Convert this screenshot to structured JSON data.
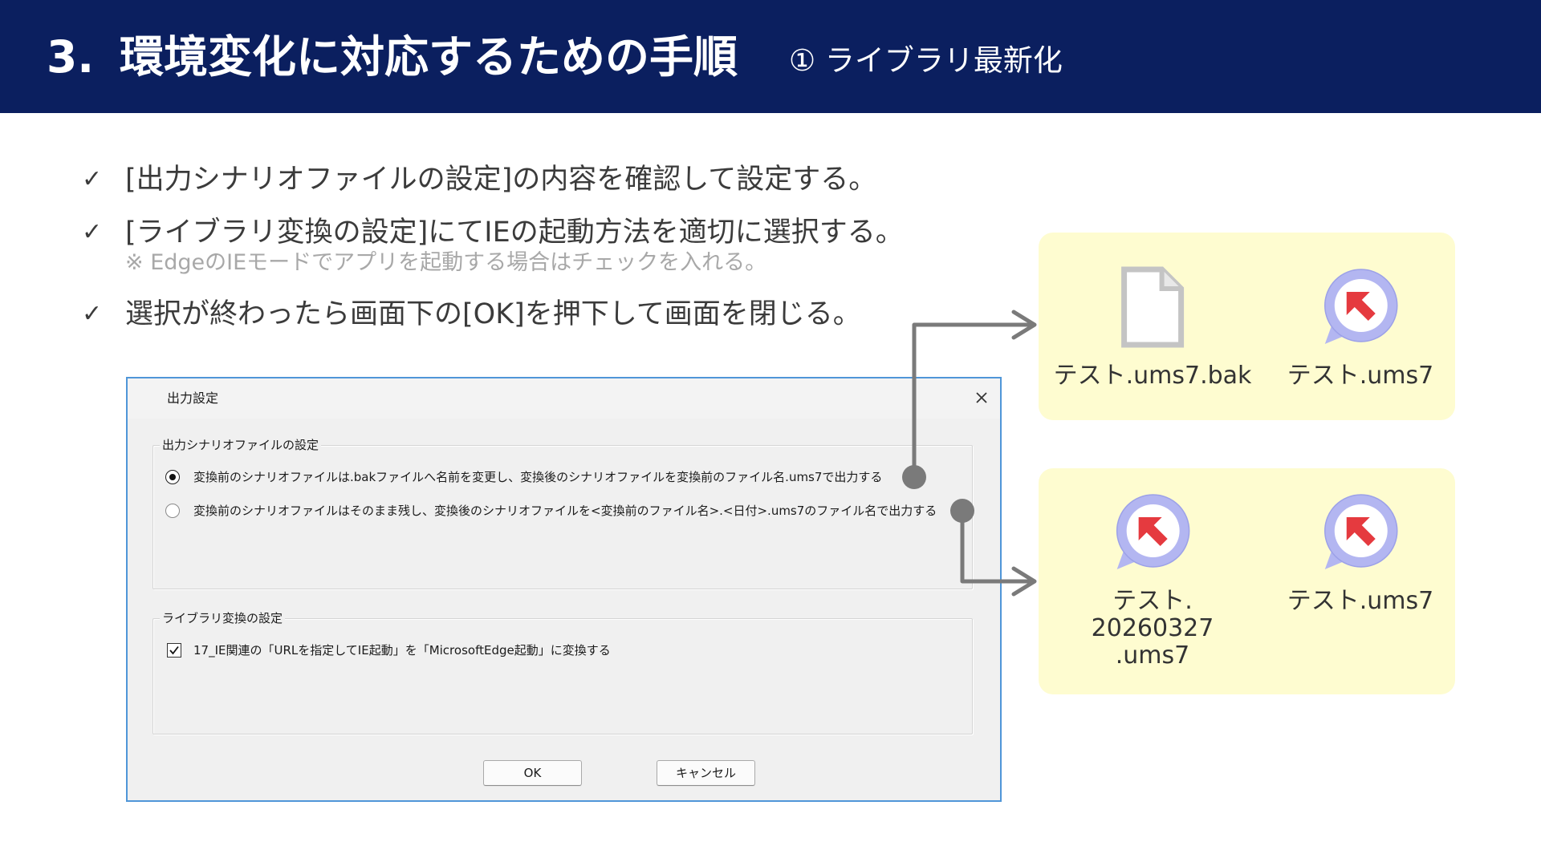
{
  "colors": {
    "header_bg": "#0b1f5f",
    "panel_bg": "#fefcd0",
    "connector": "#7a7a7a",
    "dialog_border": "#4f96d8",
    "icon_ring": "#b3b6f1",
    "icon_arrow": "#e53a3f"
  },
  "slide": {
    "section_number": "3.",
    "title": "環境変化に対応するための手順",
    "subtitle": "① ライブラリ最新化"
  },
  "bullets": [
    {
      "mark": "✓",
      "text": "[出力シナリオファイルの設定]の内容を確認して設定する。"
    },
    {
      "mark": "✓",
      "text": "[ライブラリ変換の設定]にてIEの起動方法を適切に選択する。",
      "note": "※ EdgeのIEモードでアプリを起動する場合はチェックを入れる。"
    },
    {
      "mark": "✓",
      "text": "選択が終わったら画面下の[OK]を押下して画面を閉じる。"
    }
  ],
  "dialog": {
    "title": "出力設定",
    "close_icon": "close-icon",
    "output_group": {
      "label": "出力シナリオファイルの設定",
      "options": [
        {
          "label": "変換前のシナリオファイルは.bakファイルへ名前を変更し、変換後のシナリオファイルを変換前のファイル名.ums7で出力する",
          "selected": true
        },
        {
          "label": "変換前のシナリオファイルはそのまま残し、変換後のシナリオファイルを<変換前のファイル名>.<日付>.ums7のファイル名で出力する",
          "selected": false
        }
      ]
    },
    "library_group": {
      "label": "ライブラリ変換の設定",
      "checkbox": {
        "label": "17_IE関連の「URLを指定してIE起動」を「MicrosoftEdge起動」に変換する",
        "checked": true
      }
    },
    "buttons": {
      "ok": "OK",
      "cancel": "キャンセル"
    }
  },
  "results": [
    {
      "files": [
        {
          "icon": "blank-file-icon",
          "name_lines": [
            "テスト.ums7.bak"
          ]
        },
        {
          "icon": "app-file-icon",
          "name_lines": [
            "テスト.ums7"
          ]
        }
      ]
    },
    {
      "files": [
        {
          "icon": "app-file-icon",
          "name_lines": [
            "テスト.",
            "20260327",
            ".ums7"
          ]
        },
        {
          "icon": "app-file-icon",
          "name_lines": [
            "テスト.ums7"
          ]
        }
      ]
    }
  ]
}
